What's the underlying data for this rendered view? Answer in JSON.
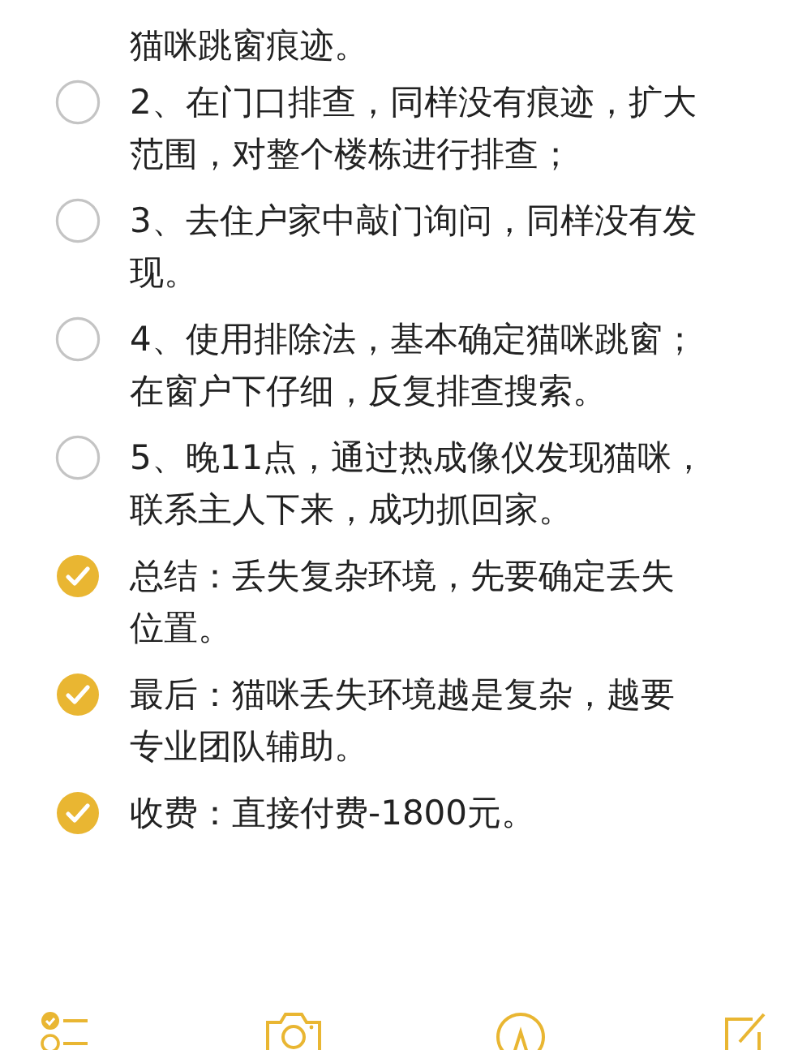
{
  "continuation_text": "猫咪跳窗痕迹。",
  "checklist": [
    {
      "lines": [
        "2、在门口排查，同样没有痕迹，扩大",
        "范围，对整个楼栋进行排查；"
      ],
      "checked": false
    },
    {
      "lines": [
        "3、去住户家中敲门询问，同样没有发",
        "现。"
      ],
      "checked": false
    },
    {
      "lines": [
        "4、使用排除法，基本确定猫咪跳窗；",
        "在窗户下仔细，反复排查搜索。"
      ],
      "checked": false
    },
    {
      "lines": [
        "5、晚11点，通过热成像仪发现猫咪，",
        "联系主人下来，成功抓回家。"
      ],
      "checked": false
    },
    {
      "lines": [
        "总结：丢失复杂环境，先要确定丢失",
        "位置。"
      ],
      "checked": true
    },
    {
      "lines": [
        "最后：猫咪丢失环境越是复杂，越要",
        "专业团队辅助。"
      ],
      "checked": true
    },
    {
      "lines": [
        "收费：直接付费-1800元。"
      ],
      "checked": true
    }
  ]
}
